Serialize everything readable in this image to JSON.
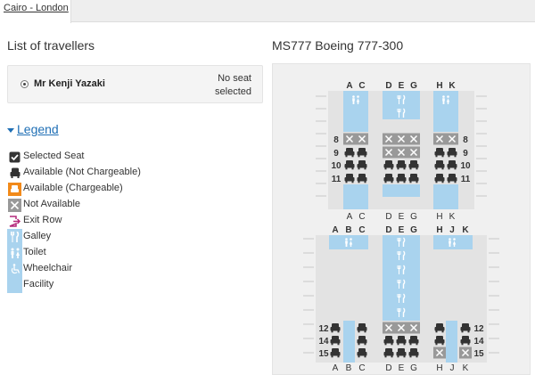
{
  "tab": {
    "label": "Cairo - London"
  },
  "travellers": {
    "title": "List of travellers",
    "items": [
      {
        "name": "Mr Kenji Yazaki",
        "status": "No seat\nselected"
      }
    ]
  },
  "legend": {
    "toggle_label": "Legend",
    "items": [
      {
        "label": "Selected Seat",
        "icon": "check-seat-icon"
      },
      {
        "label": "Available (Not Chargeable)",
        "icon": "seat-icon"
      },
      {
        "label": "Available (Chargeable)",
        "icon": "orange-seat-icon"
      },
      {
        "label": "Not Available",
        "icon": "x-icon"
      },
      {
        "label": "Exit Row",
        "icon": "exit-icon"
      },
      {
        "label": "Galley",
        "icon": "fork-knife-icon"
      },
      {
        "label": "Toilet",
        "icon": "toilet-icon"
      },
      {
        "label": "Wheelchair",
        "icon": "wheelchair-icon"
      },
      {
        "label": "Facility",
        "icon": ""
      }
    ]
  },
  "aircraft": {
    "title": "MS777 Boeing 777-300",
    "colors": {
      "facility": "#a9d3ee",
      "unavailable": "#999999",
      "seat": "#333333",
      "selected": "#333333",
      "chargeable": "#f28a1a",
      "exit": "#b4287a",
      "link": "#1f6fb5"
    },
    "section1": {
      "columns_top": [
        "A",
        "C",
        "D",
        "E",
        "G",
        "H",
        "K"
      ],
      "columns_bottom": [
        "A",
        "C",
        "D",
        "E",
        "G",
        "H",
        "K"
      ],
      "rows": [
        {
          "num": "8",
          "seats": [
            "x",
            "x",
            "x",
            "x",
            "x",
            "x",
            "x"
          ]
        },
        {
          "num": "9",
          "seats": [
            "s",
            "s",
            "x",
            "x",
            "x",
            "s",
            "s"
          ]
        },
        {
          "num": "10",
          "seats": [
            "s",
            "s",
            "s",
            "s",
            "s",
            "s",
            "s"
          ]
        },
        {
          "num": "11",
          "seats": [
            "s",
            "s",
            "s",
            "s",
            "s",
            "s",
            "s"
          ]
        }
      ]
    },
    "section2": {
      "columns_top": [
        "A",
        "B",
        "C",
        "D",
        "E",
        "G",
        "H",
        "J",
        "K"
      ],
      "columns_bottom": [
        "A",
        "B",
        "C",
        "D",
        "E",
        "G",
        "H",
        "J",
        "K"
      ],
      "rows": [
        {
          "num": "12",
          "seats": [
            "s",
            "",
            "s",
            "x",
            "x",
            "x",
            "s",
            "",
            "s"
          ]
        },
        {
          "num": "14",
          "seats": [
            "s",
            "",
            "s",
            "s",
            "s",
            "s",
            "s",
            "",
            "s"
          ]
        },
        {
          "num": "15",
          "seats": [
            "s",
            "",
            "s",
            "s",
            "s",
            "s",
            "x",
            "",
            "x"
          ]
        }
      ]
    }
  }
}
